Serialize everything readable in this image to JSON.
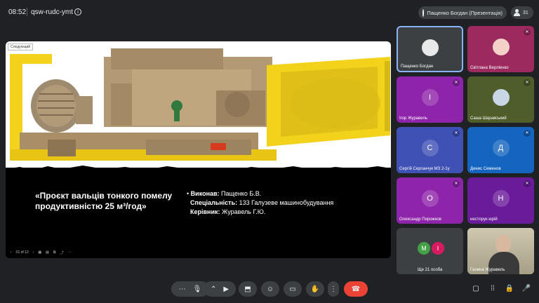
{
  "header": {
    "time": "08:52",
    "meet_code": "qsw-rudc-ymt",
    "presenter_chip": "Пащенко Богдан (Презентація)",
    "participants_count": "31"
  },
  "presentation": {
    "corner_label": "Следующий",
    "title": "«Проєкт вальців тонкого помелу продуктивністю 25 м³/год»",
    "info": [
      {
        "label": "Виконав:",
        "value": " Пащенко Б.В."
      },
      {
        "label": "Спеціальність:",
        "value": " 133 Галузеве машинобудування"
      },
      {
        "label": "Керівник:",
        "value": " Журавель Г.Ю."
      }
    ],
    "page_indicator": "01 of 12"
  },
  "participants": [
    {
      "name": "Пащенко Богдан",
      "bg": "#3c4043",
      "initial": ""
    },
    {
      "name": "Світлана Верліенко",
      "bg": "#9c2a5e",
      "initial": ""
    },
    {
      "name": "Ігор Журавель",
      "bg": "#8e24aa",
      "initial": "І"
    },
    {
      "name": "Саша Шаравський",
      "bg": "#4e5d2a",
      "initial": ""
    },
    {
      "name": "Сергій Серганчук МЗ 2-1у",
      "bg": "#3f51b5",
      "initial": "С"
    },
    {
      "name": "Денис Семенов",
      "bg": "#1565c0",
      "initial": "Д"
    },
    {
      "name": "Олександр Пирожков",
      "bg": "#8e24aa",
      "initial": "О"
    },
    {
      "name": "несторук юрій",
      "bg": "#6a1b9a",
      "initial": "Н"
    },
    {
      "name": "Ще 21 особа",
      "bg": "#3c4043",
      "initial": ""
    },
    {
      "name": "Галина Журавель",
      "bg": "#c9c2a8",
      "initial": ""
    }
  ],
  "others_initials": [
    "М",
    "І"
  ],
  "colors": {
    "accent": "#8ab4f8",
    "end_call": "#ea4335",
    "slide_yellow": "#f2d21b"
  }
}
